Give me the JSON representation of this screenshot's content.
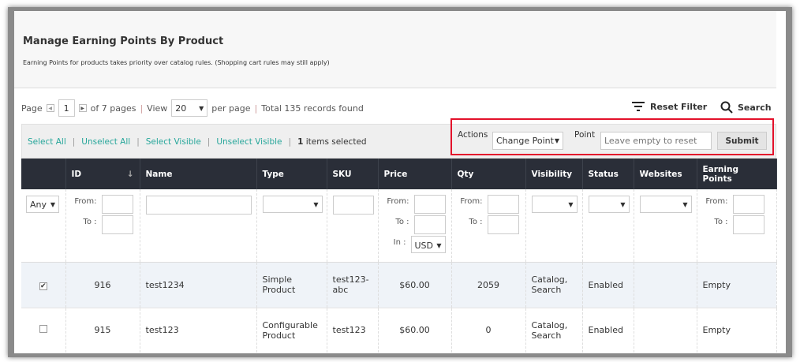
{
  "header": {
    "title": "Manage Earning Points By Product",
    "note": "Earning Points for products takes priority over catalog rules. (Shopping cart rules may still apply)"
  },
  "pager": {
    "page_label": "Page",
    "page": "1",
    "of_pages": "of 7 pages",
    "view_label": "View",
    "per_page": "20",
    "per_page_label": "per page",
    "total": "Total 135 records found"
  },
  "tools": {
    "reset_filter": "Reset Filter",
    "search": "Search"
  },
  "mass": {
    "select_all": "Select All",
    "unselect_all": "Unselect All",
    "select_visible": "Select Visible",
    "unselect_visible": "Unselect Visible",
    "selected_count": "1",
    "selected_label": "items selected",
    "actions_label": "Actions",
    "action_value": "Change Point",
    "point_label": "Point",
    "point_placeholder": "Leave empty to reset",
    "submit": "Submit",
    "highlight_color": "#e3112b"
  },
  "columns": [
    "ID",
    "Name",
    "Type",
    "SKU",
    "Price",
    "Qty",
    "Visibility",
    "Status",
    "Websites",
    "Earning Points"
  ],
  "filters": {
    "any": "Any",
    "from": "From:",
    "to": "To :",
    "in": "In :",
    "currency": "USD"
  },
  "rows": [
    {
      "checked": true,
      "id": "916",
      "name": "test1234",
      "type": "Simple Product",
      "sku": "test123-abc",
      "price": "$60.00",
      "qty": "2059",
      "visibility": "Catalog, Search",
      "status": "Enabled",
      "websites": "",
      "points": "Empty"
    },
    {
      "checked": false,
      "id": "915",
      "name": "test123",
      "type": "Configurable Product",
      "sku": "test123",
      "price": "$60.00",
      "qty": "0",
      "visibility": "Catalog, Search",
      "status": "Enabled",
      "websites": "",
      "points": "Empty"
    }
  ]
}
